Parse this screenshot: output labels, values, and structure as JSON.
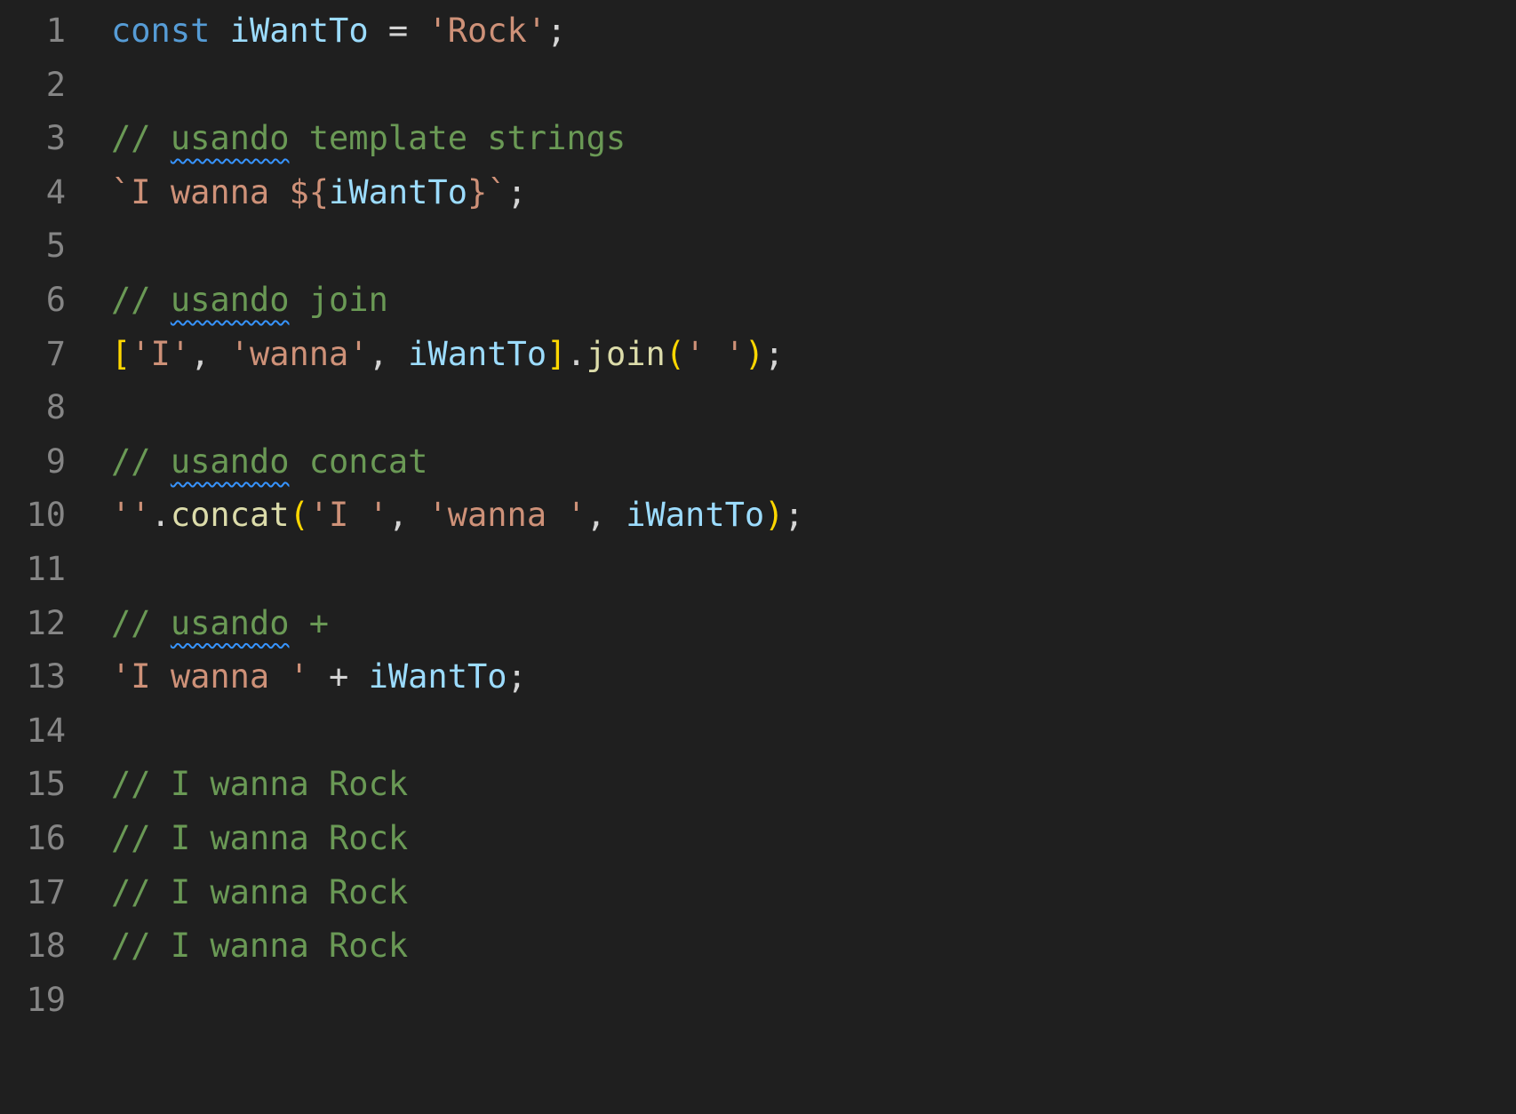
{
  "editor": {
    "lines": [
      {
        "number": "1",
        "tokens": [
          {
            "text": "const",
            "kind": "kw"
          },
          {
            "text": " ",
            "kind": "op"
          },
          {
            "text": "iWantTo",
            "kind": "var"
          },
          {
            "text": " = ",
            "kind": "op"
          },
          {
            "text": "'Rock'",
            "kind": "str"
          },
          {
            "text": ";",
            "kind": "punc"
          }
        ]
      },
      {
        "number": "2",
        "tokens": []
      },
      {
        "number": "3",
        "tokens": [
          {
            "text": "// ",
            "kind": "com"
          },
          {
            "text": "usando",
            "kind": "com",
            "squiggle": true
          },
          {
            "text": " template strings",
            "kind": "com"
          }
        ]
      },
      {
        "number": "4",
        "tokens": [
          {
            "text": "`I wanna ",
            "kind": "str"
          },
          {
            "text": "${",
            "kind": "str"
          },
          {
            "text": "iWantTo",
            "kind": "var"
          },
          {
            "text": "}",
            "kind": "str"
          },
          {
            "text": "`",
            "kind": "str"
          },
          {
            "text": ";",
            "kind": "punc"
          }
        ]
      },
      {
        "number": "5",
        "tokens": []
      },
      {
        "number": "6",
        "tokens": [
          {
            "text": "// ",
            "kind": "com"
          },
          {
            "text": "usando",
            "kind": "com",
            "squiggle": true
          },
          {
            "text": " join",
            "kind": "com"
          }
        ]
      },
      {
        "number": "7",
        "tokens": [
          {
            "text": "[",
            "kind": "br"
          },
          {
            "text": "'I'",
            "kind": "str"
          },
          {
            "text": ", ",
            "kind": "punc"
          },
          {
            "text": "'wanna'",
            "kind": "str"
          },
          {
            "text": ", ",
            "kind": "punc"
          },
          {
            "text": "iWantTo",
            "kind": "var"
          },
          {
            "text": "]",
            "kind": "br"
          },
          {
            "text": ".",
            "kind": "punc"
          },
          {
            "text": "join",
            "kind": "fn"
          },
          {
            "text": "(",
            "kind": "br"
          },
          {
            "text": "' '",
            "kind": "str"
          },
          {
            "text": ")",
            "kind": "br"
          },
          {
            "text": ";",
            "kind": "punc"
          }
        ]
      },
      {
        "number": "8",
        "tokens": []
      },
      {
        "number": "9",
        "tokens": [
          {
            "text": "// ",
            "kind": "com"
          },
          {
            "text": "usando",
            "kind": "com",
            "squiggle": true
          },
          {
            "text": " concat",
            "kind": "com"
          }
        ]
      },
      {
        "number": "10",
        "tokens": [
          {
            "text": "''",
            "kind": "str"
          },
          {
            "text": ".",
            "kind": "punc"
          },
          {
            "text": "concat",
            "kind": "fn"
          },
          {
            "text": "(",
            "kind": "br"
          },
          {
            "text": "'I '",
            "kind": "str"
          },
          {
            "text": ", ",
            "kind": "punc"
          },
          {
            "text": "'wanna '",
            "kind": "str"
          },
          {
            "text": ", ",
            "kind": "punc"
          },
          {
            "text": "iWantTo",
            "kind": "var"
          },
          {
            "text": ")",
            "kind": "br"
          },
          {
            "text": ";",
            "kind": "punc"
          }
        ]
      },
      {
        "number": "11",
        "tokens": []
      },
      {
        "number": "12",
        "tokens": [
          {
            "text": "// ",
            "kind": "com"
          },
          {
            "text": "usando",
            "kind": "com",
            "squiggle": true
          },
          {
            "text": " +",
            "kind": "com"
          }
        ]
      },
      {
        "number": "13",
        "tokens": [
          {
            "text": "'I wanna '",
            "kind": "str"
          },
          {
            "text": " + ",
            "kind": "op"
          },
          {
            "text": "iWantTo",
            "kind": "var"
          },
          {
            "text": ";",
            "kind": "punc"
          }
        ]
      },
      {
        "number": "14",
        "tokens": []
      },
      {
        "number": "15",
        "tokens": [
          {
            "text": "// I wanna Rock",
            "kind": "com"
          }
        ]
      },
      {
        "number": "16",
        "tokens": [
          {
            "text": "// I wanna Rock",
            "kind": "com"
          }
        ]
      },
      {
        "number": "17",
        "tokens": [
          {
            "text": "// I wanna Rock",
            "kind": "com"
          }
        ]
      },
      {
        "number": "18",
        "tokens": [
          {
            "text": "// I wanna Rock",
            "kind": "com"
          }
        ]
      },
      {
        "number": "19",
        "tokens": []
      }
    ]
  },
  "colors": {
    "background": "#1f1f1f",
    "line_number": "#858585",
    "keyword": "#569cd6",
    "variable": "#9cdcfe",
    "string": "#ce9178",
    "comment": "#6a9955",
    "function": "#dcdcaa",
    "bracket": "#ffd700",
    "spell_squiggle": "#3794ff"
  }
}
